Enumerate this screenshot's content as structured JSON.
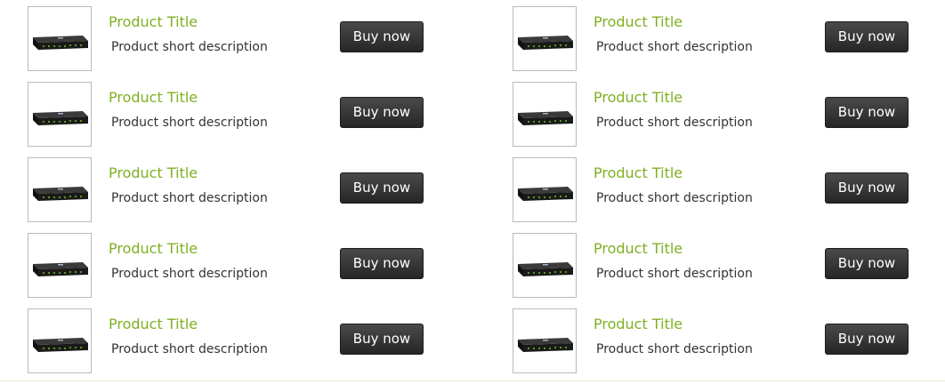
{
  "products_left": [
    {
      "title": "Product Title",
      "description": "Product short description",
      "buy_label": "Buy now"
    },
    {
      "title": "Product Title",
      "description": "Product short description",
      "buy_label": "Buy now"
    },
    {
      "title": "Product Title",
      "description": "Product short description",
      "buy_label": "Buy now"
    },
    {
      "title": "Product Title",
      "description": "Product short description",
      "buy_label": "Buy now"
    },
    {
      "title": "Product Title",
      "description": "Product short description",
      "buy_label": "Buy now"
    }
  ],
  "products_right": [
    {
      "title": "Product Title",
      "description": "Product short description",
      "buy_label": "Buy now"
    },
    {
      "title": "Product Title",
      "description": "Product short description",
      "buy_label": "Buy now"
    },
    {
      "title": "Product Title",
      "description": "Product short description",
      "buy_label": "Buy now"
    },
    {
      "title": "Product Title",
      "description": "Product short description",
      "buy_label": "Buy now"
    },
    {
      "title": "Product Title",
      "description": "Product short description",
      "buy_label": "Buy now"
    }
  ],
  "product_image_icon": "network-device-icon",
  "colors": {
    "title": "#7fb022",
    "description": "#333333",
    "button_bg": "#333333",
    "button_text": "#ffffff",
    "thumb_border": "#b9b9b9"
  }
}
